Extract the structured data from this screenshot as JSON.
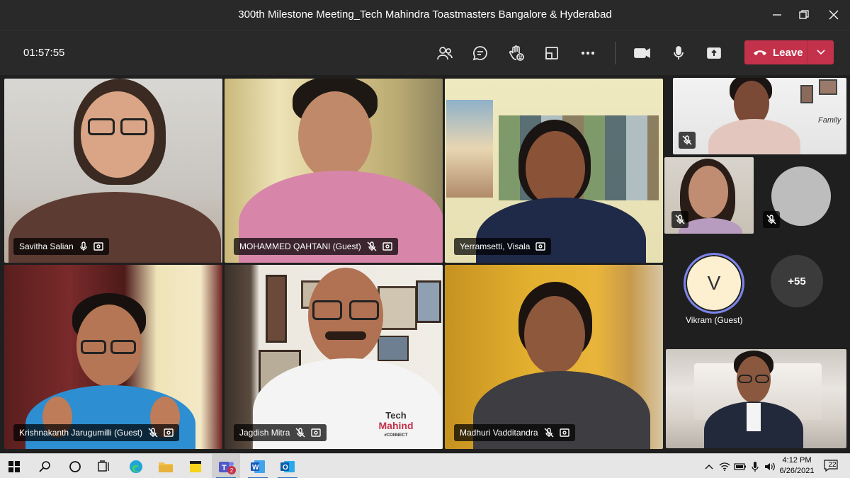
{
  "window": {
    "title": "300th Milestone Meeting_Tech Mahindra Toastmasters Bangalore & Hyderabad"
  },
  "toolbar": {
    "timer": "01:57:55",
    "leave_label": "Leave"
  },
  "participants": [
    {
      "name": "Savitha Salian"
    },
    {
      "name": "MOHAMMED QAHTANI (Guest)"
    },
    {
      "name": "Yerramsetti, Visala"
    },
    {
      "name": "Krishnakanth Jarugumilli (Guest)"
    },
    {
      "name": "Jagdish Mitra"
    },
    {
      "name": "Madhuri Vadditandra"
    }
  ],
  "side": {
    "vikram_initial": "V",
    "vikram_name": "Vikram (Guest)",
    "overflow_count": "+55"
  },
  "shirt_text": {
    "line1": "Tech",
    "line2": "Mahind",
    "line3": "#CONNECT"
  },
  "wall_text": "Family",
  "taskbar": {
    "time": "4:12 PM",
    "date": "6/26/2021",
    "notifications": "22",
    "teams_badge": "2"
  },
  "colors": {
    "leave_red": "#c4314b",
    "avatar_border": "#7b83eb",
    "avatar_fill": "#fdf0d1"
  }
}
